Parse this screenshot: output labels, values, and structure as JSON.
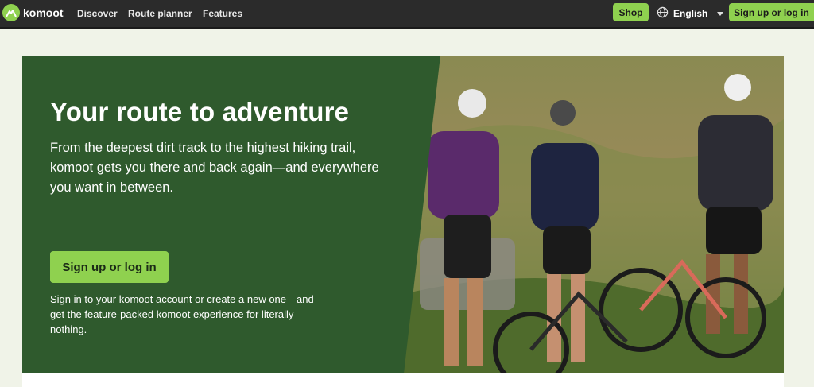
{
  "header": {
    "brand": "komoot",
    "nav": [
      "Discover",
      "Route planner",
      "Features"
    ],
    "shop_label": "Shop",
    "language": "English",
    "signup_label": "Sign up or log in"
  },
  "hero": {
    "title": "Your route to adventure",
    "subtitle": "From the deepest dirt track to the highest hiking trail, komoot gets you there and back again—and everywhere you want in between.",
    "button_label": "Sign up or log in",
    "note": "Sign in to your komoot account or create a new one—and get the feature-packed komoot experience for literally nothing."
  },
  "colors": {
    "accent": "#8fd14f",
    "topbar": "#2b2b2b",
    "panel": "#2f5a2d",
    "page_bg": "#f0f3e8"
  },
  "icons": [
    "komoot-logo-icon",
    "globe-icon",
    "chevron-down-icon"
  ]
}
